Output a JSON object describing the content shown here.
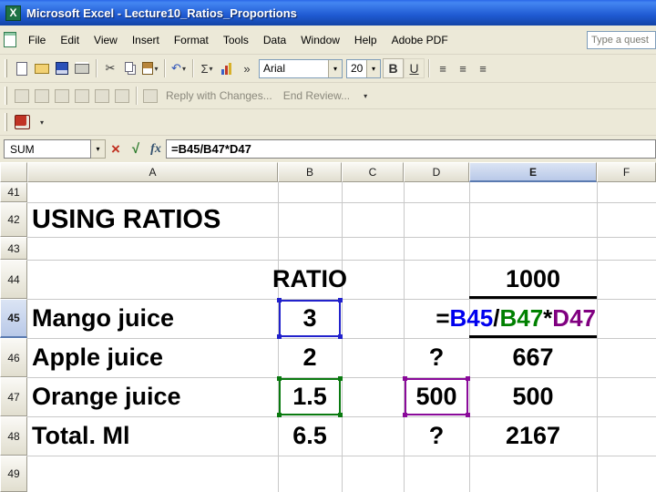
{
  "window": {
    "title": "Microsoft Excel - Lecture10_Ratios_Proportions"
  },
  "menu": {
    "items": [
      "File",
      "Edit",
      "View",
      "Insert",
      "Format",
      "Tools",
      "Data",
      "Window",
      "Help",
      "Adobe PDF"
    ],
    "ask_box": "Type a quest"
  },
  "toolbar": {
    "font_name": "Arial",
    "font_size": "20",
    "bold_label": "B",
    "underline_label": "U",
    "reply_label": "Reply with Changes...",
    "end_review_label": "End Review..."
  },
  "formula_bar": {
    "name_box": "SUM",
    "formula": "=B45/B47*D47"
  },
  "icons": {
    "dropdown": "▾",
    "more": "»",
    "sigma": "Σ",
    "scissors": "✂",
    "undo": "↶",
    "lines": "≡",
    "cancel": "×",
    "check": "√",
    "fx": "fx"
  },
  "sheet": {
    "columns": [
      "A",
      "B",
      "C",
      "D",
      "E",
      "F"
    ],
    "rows": [
      "41",
      "42",
      "43",
      "44",
      "45",
      "46",
      "47",
      "48",
      "49"
    ],
    "active_column": "E",
    "active_row": "45"
  },
  "cells": {
    "a42": "USING RATIOS",
    "b44": "RATIO",
    "e44": "1000",
    "a45": "Mango juice",
    "b45": "3",
    "formula": {
      "eq": "=",
      "ref1": "B45",
      "op1": "/",
      "ref2": "B47",
      "op2": "*",
      "ref3": "D47"
    },
    "a46": "Apple juice",
    "b46": "2",
    "d46": "?",
    "e46": "667",
    "a47": "Orange juice",
    "b47": "1.5",
    "d47": "500",
    "e47": "500",
    "a48": "Total. Ml",
    "b48": "6.5",
    "d48": "?",
    "e48": "2167"
  },
  "colors": {
    "ref_blue": "#0000ee",
    "ref_green": "#008000",
    "ref_purple": "#800080",
    "active_header": "#b9c9e8"
  }
}
